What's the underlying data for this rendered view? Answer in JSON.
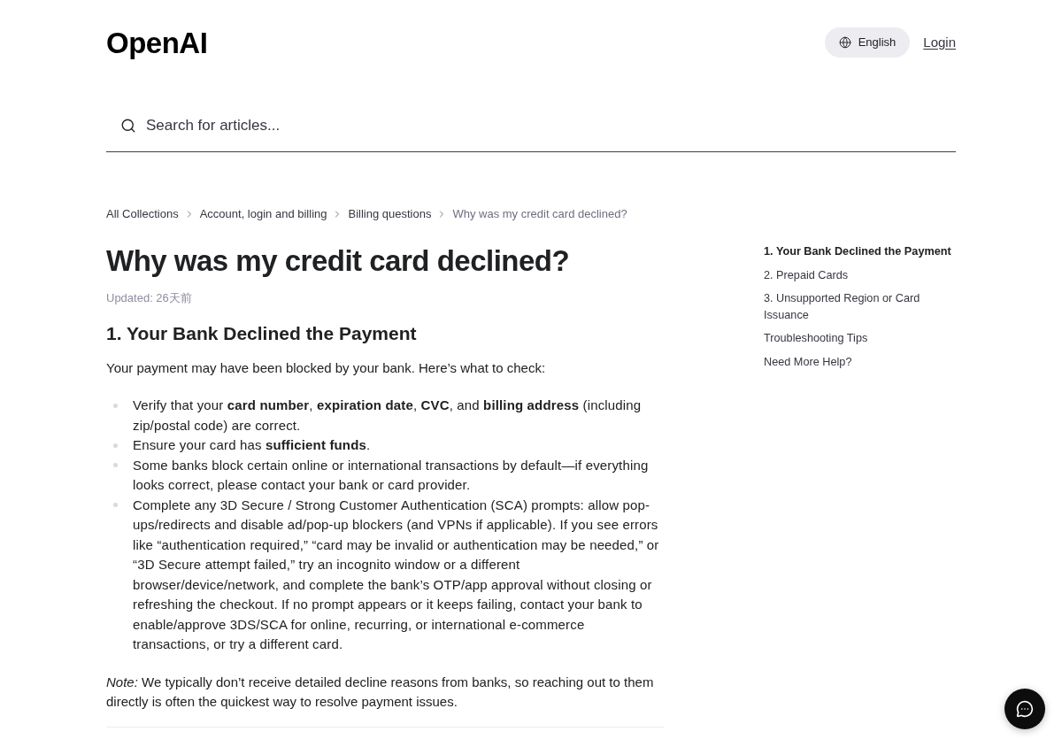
{
  "header": {
    "logo": "OpenAI",
    "language": "English",
    "login": "Login"
  },
  "search": {
    "placeholder": "Search for articles..."
  },
  "breadcrumbs": [
    {
      "label": "All Collections",
      "current": false
    },
    {
      "label": "Account, login and billing",
      "current": false
    },
    {
      "label": "Billing questions",
      "current": false
    },
    {
      "label": "Why was my credit card declined?",
      "current": true
    }
  ],
  "article": {
    "title": "Why was my credit card declined?",
    "updated": "Updated: 26天前",
    "heading": "1. Your Bank Declined the Payment",
    "intro": "Your payment may have been blocked by your bank. Here’s what to check:",
    "bullets": [
      "Verify that your **card number**, **expiration date**, **CVC**, and **billing address** (including zip/postal code) are correct.",
      "Ensure your card has **sufficient funds**.",
      "Some banks block certain online or international transactions by default—if everything looks correct, please contact your bank or card provider.",
      "Complete any 3D Secure / Strong Customer Authentication (SCA) prompts: allow pop-ups/redirects and disable ad/pop-up blockers (and VPNs if applicable). If you see errors like “authentication required,” “card may be invalid or authentication may be needed,” or “3D Secure attempt failed,” try an incognito window or a different browser/device/network, and complete the bank’s OTP/app approval without closing or refreshing the checkout. If no prompt appears or it keeps failing, contact your bank to enable/approve 3DS/SCA for online, recurring, or international e-commerce transactions, or try a different card."
    ],
    "note": "*Note:* We typically don’t receive detailed decline reasons from banks, so reaching out to them directly is often the quickest way to resolve payment issues."
  },
  "toc": [
    {
      "label": "1. Your Bank Declined the Payment",
      "selected": true
    },
    {
      "label": "2. Prepaid Cards",
      "selected": false
    },
    {
      "label": "3. Unsupported Region or Card Issuance",
      "selected": false
    },
    {
      "label": "Troubleshooting Tips",
      "selected": false
    },
    {
      "label": "Need More Help?",
      "selected": false
    }
  ]
}
